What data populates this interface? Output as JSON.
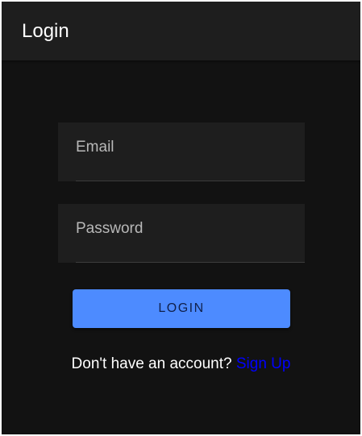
{
  "app_bar": {
    "title": "Login"
  },
  "form": {
    "email": {
      "label": "Email",
      "value": ""
    },
    "password": {
      "label": "Password",
      "value": ""
    },
    "login_button_label": "LOGIN"
  },
  "signup": {
    "prompt": "Don't have an account?",
    "link_label": "Sign Up"
  },
  "colors": {
    "background": "#121212",
    "app_bar": "#1e1e1e",
    "field_background": "#1e1e1e",
    "primary_button": "#4d8bff",
    "link": "#0000ff"
  }
}
